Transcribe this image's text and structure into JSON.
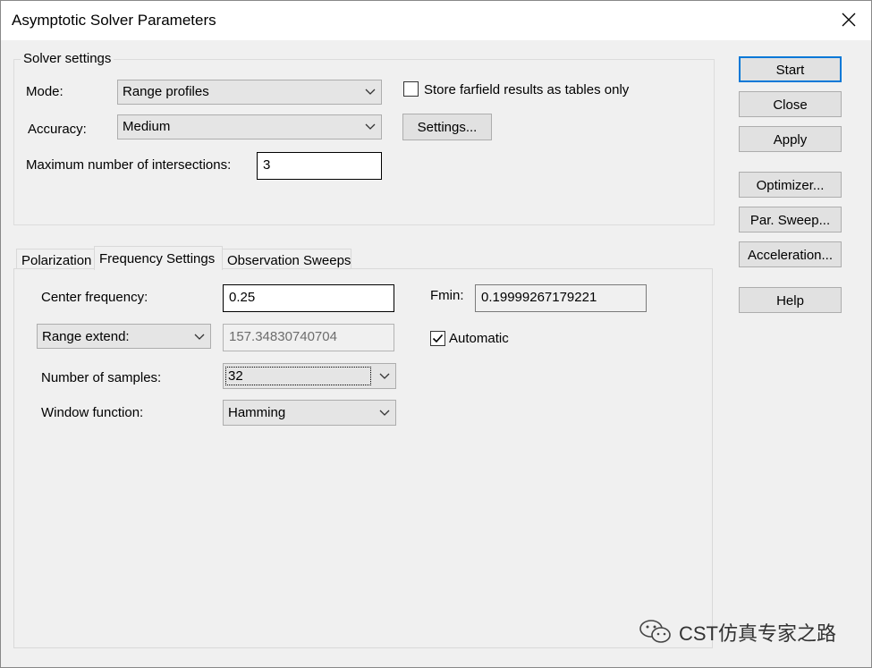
{
  "window": {
    "title": "Asymptotic Solver Parameters"
  },
  "solver_settings": {
    "group_label": "Solver settings",
    "mode_label": "Mode:",
    "mode_value": "Range profiles",
    "accuracy_label": "Accuracy:",
    "accuracy_value": "Medium",
    "max_intersections_label": "Maximum number of intersections:",
    "max_intersections_value": "3",
    "store_farfield_label": "Store farfield results as tables only",
    "store_farfield_checked": false,
    "settings_button": "Settings..."
  },
  "side_buttons": {
    "start": "Start",
    "close": "Close",
    "apply": "Apply",
    "optimizer": "Optimizer...",
    "par_sweep": "Par. Sweep...",
    "acceleration": "Acceleration...",
    "help": "Help"
  },
  "tabs": [
    {
      "label": "Polarization",
      "active": false
    },
    {
      "label": "Frequency Settings",
      "active": true
    },
    {
      "label": "Observation Sweeps",
      "active": false
    }
  ],
  "frequency": {
    "center_label": "Center frequency:",
    "center_value": "0.25",
    "fmin_label": "Fmin:",
    "fmin_value": "0.19999267179221",
    "range_mode_value": "Range extend:",
    "range_extend_value": "157.34830740704",
    "automatic_label": "Automatic",
    "automatic_checked": true,
    "samples_label": "Number of samples:",
    "samples_value": "32",
    "window_label": "Window function:",
    "window_value": "Hamming"
  },
  "watermark": {
    "text": "CST仿真专家之路",
    "icon": "wechat-icon"
  }
}
